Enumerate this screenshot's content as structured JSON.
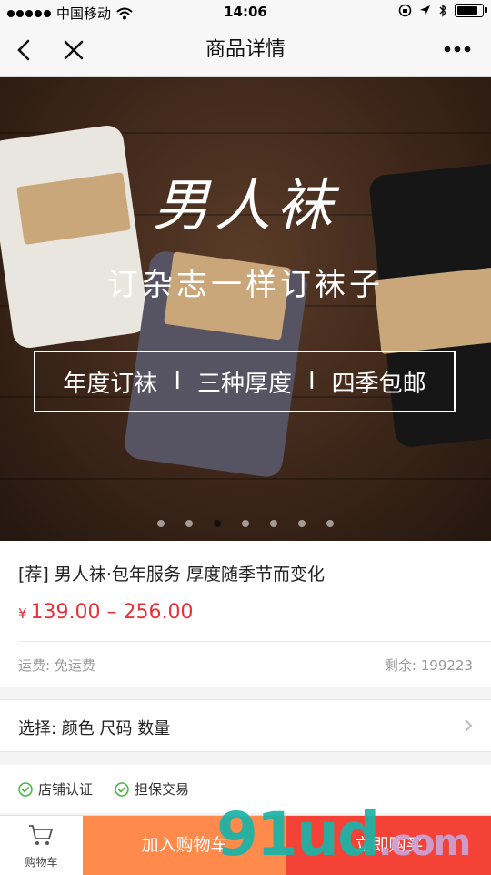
{
  "status_bar": {
    "carrier": "中国移动",
    "time": "14:06"
  },
  "nav": {
    "title": "商品详情"
  },
  "banner": {
    "brand": "男人袜",
    "slogan": "订杂志一样订袜子",
    "features": [
      "年度订袜",
      "三种厚度",
      "四季包邮"
    ],
    "separator": "I",
    "page_count": 7,
    "active_page": 3
  },
  "product": {
    "title": "[荐] 男人袜·包年服务 厚度随季节而变化",
    "currency": "¥",
    "price_range": "139.00 – 256.00",
    "shipping": "运费: 免运费",
    "stock": "剩余: 199223"
  },
  "select": {
    "label": "选择: 颜色 尺码 数量"
  },
  "badges": [
    "店铺认证",
    "担保交易"
  ],
  "bottom_bar": {
    "cart_label": "购物车",
    "add_to_cart": "加入购物车",
    "buy_now": "立即购买"
  },
  "watermark": {
    "text": "91ud",
    "suffix": ".com"
  },
  "colors": {
    "price": "#e8313a",
    "add_to_cart_bg": "#ff8a4c",
    "buy_now_bg": "#f44336",
    "badge_check": "#3fbb3a"
  }
}
